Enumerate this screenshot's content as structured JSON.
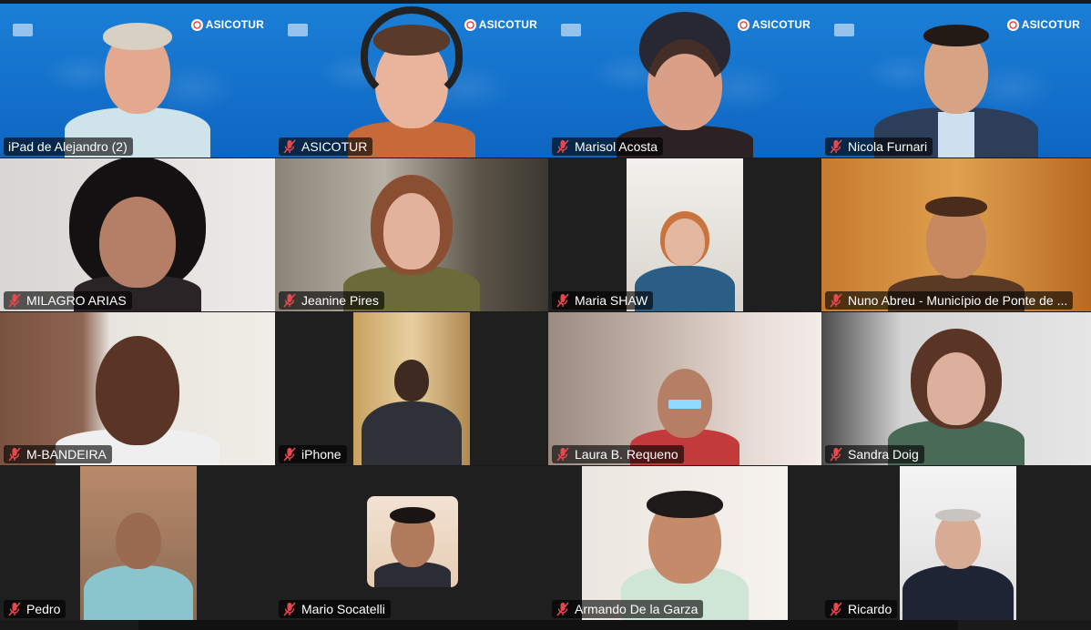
{
  "window": {
    "title": ""
  },
  "participants": [
    {
      "name": "iPad de Alejandro (2)",
      "muted": false,
      "active": true
    },
    {
      "name": "ASICOTUR",
      "muted": true
    },
    {
      "name": "Marisol Acosta",
      "muted": true
    },
    {
      "name": "Nicola Furnari",
      "muted": true
    },
    {
      "name": "MILAGRO ARIAS",
      "muted": true
    },
    {
      "name": "Jeanine Pires",
      "muted": true
    },
    {
      "name": "Maria SHAW",
      "muted": true
    },
    {
      "name": "Nuno Abreu - Município de Ponte de ...",
      "muted": true
    },
    {
      "name": "M-BANDEIRA",
      "muted": true
    },
    {
      "name": "iPhone",
      "muted": true
    },
    {
      "name": "Laura B. Requeno",
      "muted": true
    },
    {
      "name": "Sandra Doig",
      "muted": true
    },
    {
      "name": "Pedro",
      "muted": true
    },
    {
      "name": "Mario Socatelli",
      "muted": true
    },
    {
      "name": "Armando De la Garza",
      "muted": true
    },
    {
      "name": "Ricardo",
      "muted": true
    }
  ],
  "background": {
    "logo_text": "ASICOTUR"
  },
  "colors": {
    "active_speaker": "#23d18b",
    "muted_icon": "#e5484d",
    "asicotur_blue": "#1479d0"
  }
}
